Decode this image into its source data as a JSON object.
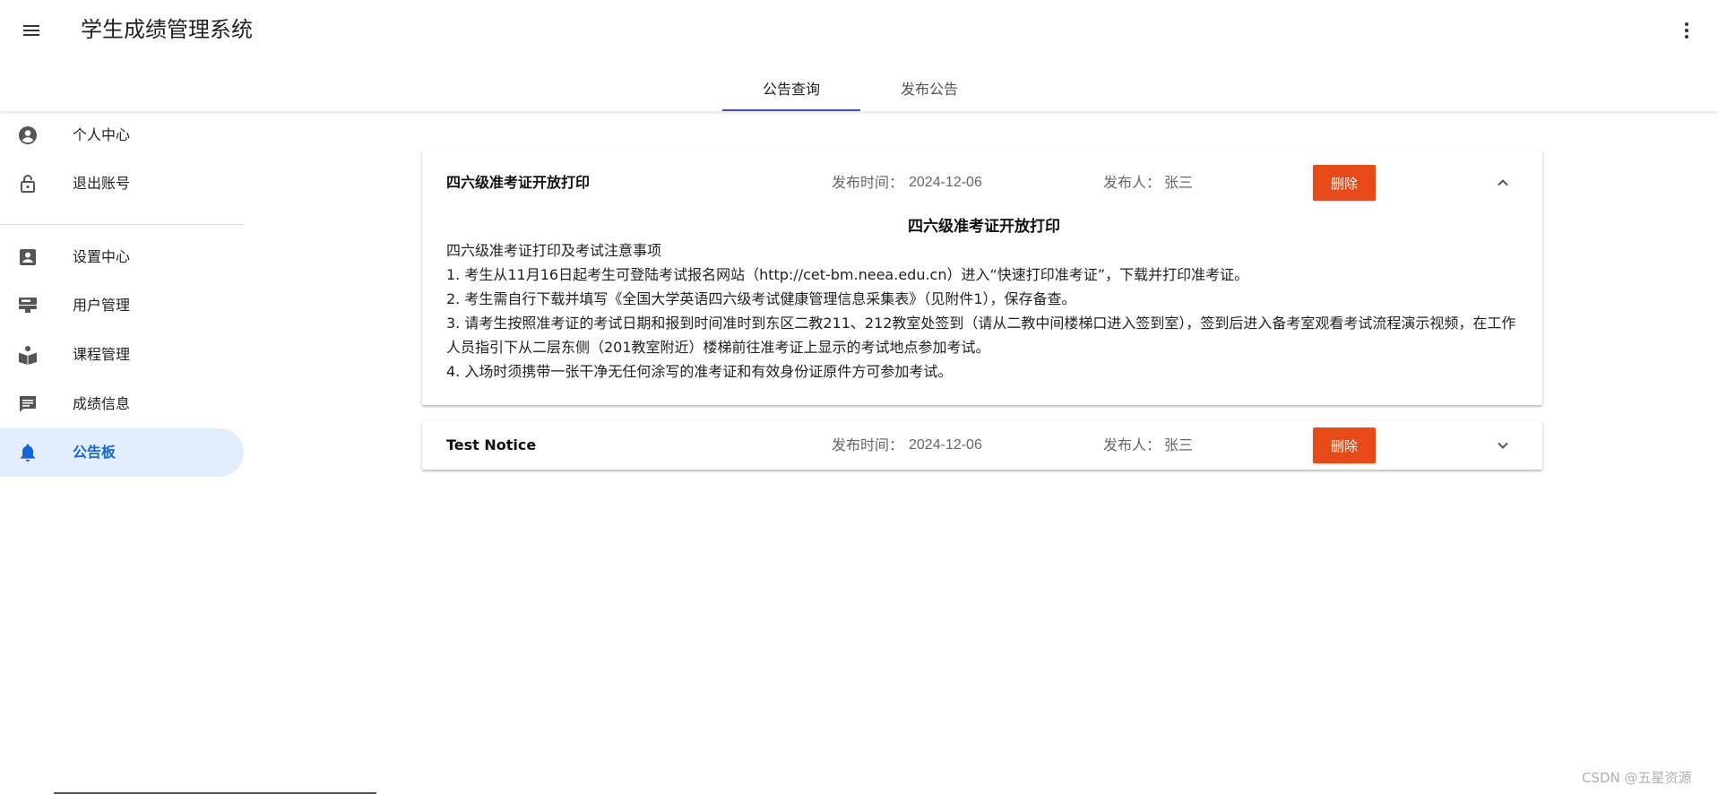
{
  "app": {
    "title": "学生成绩管理系统"
  },
  "tabs": [
    {
      "label": "公告查询",
      "active": true
    },
    {
      "label": "发布公告",
      "active": false
    }
  ],
  "sidebar": {
    "items": [
      {
        "label": "个人中心",
        "icon": "account-circle-icon"
      },
      {
        "label": "退出账号",
        "icon": "lock-icon"
      },
      {
        "label": "设置中心",
        "icon": "account-box-icon"
      },
      {
        "label": "用户管理",
        "icon": "users-manage-icon"
      },
      {
        "label": "课程管理",
        "icon": "book-reader-icon"
      },
      {
        "label": "成绩信息",
        "icon": "message-icon"
      },
      {
        "label": "公告板",
        "icon": "bell-icon",
        "active": true
      }
    ]
  },
  "notices": [
    {
      "title": "四六级准考证开放打印",
      "time_label": "发布时间：",
      "time": "2024-12-06",
      "author_label": "发布人：",
      "author": "张三",
      "delete_label": "删除",
      "expanded": true,
      "body_title": "四六级准考证开放打印",
      "body_lines": [
        "四六级准考证打印及考试注意事项",
        "1. 考生从11月16日起考生可登陆考试报名网站（http://cet-bm.neea.edu.cn）进入“快速打印准考证”，下载并打印准考证。",
        "2. 考生需自行下载并填写《全国大学英语四六级考试健康管理信息采集表》（见附件1），保存备查。",
        "3. 请考生按照准考证的考试日期和报到时间准时到东区二教211、212教室处签到（请从二教中间楼梯口进入签到室），签到后进入备考室观看考试流程演示视频，在工作人员指引下从二层东侧（201教室附近）楼梯前往准考证上显示的考试地点参加考试。",
        "4. 入场时须携带一张干净无任何涂写的准考证和有效身份证原件方可参加考试。"
      ]
    },
    {
      "title": "Test Notice",
      "time_label": "发布时间：",
      "time": "2024-12-06",
      "author_label": "发布人：",
      "author": "张三",
      "delete_label": "删除",
      "expanded": false
    }
  ],
  "watermark": "CSDN @五星资源",
  "colors": {
    "accent": "#3f51b5",
    "active_nav": "#1565d8",
    "active_nav_bg": "#e3eefc",
    "danger": "#e64a19"
  }
}
